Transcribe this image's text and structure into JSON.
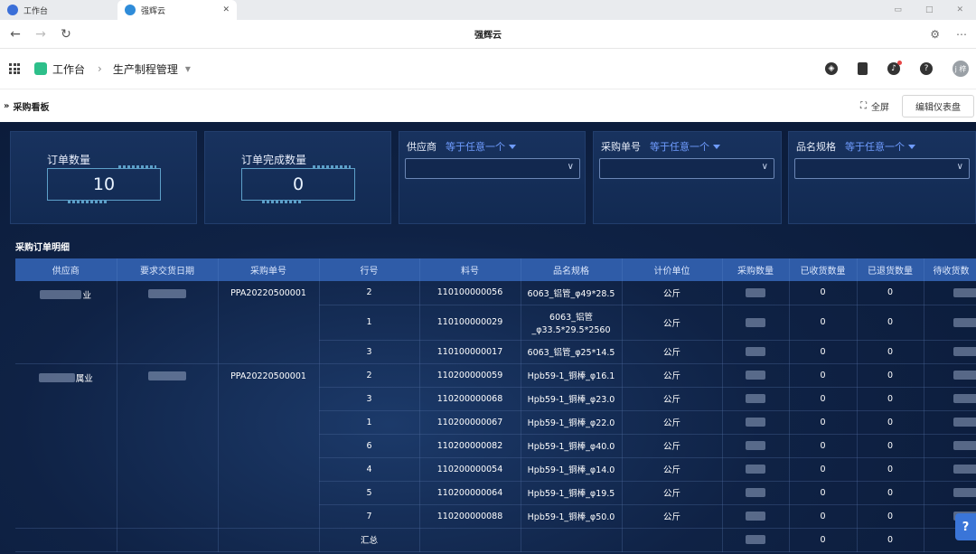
{
  "browser": {
    "tabs": [
      {
        "label": "工作台",
        "icon_color": "#3b6fd8",
        "active": false
      },
      {
        "label": "强辉云",
        "icon_color": "#2f8cd9",
        "active": true
      }
    ],
    "close_glyph": "✕",
    "page_title": "强辉云",
    "nav": {
      "back": "←",
      "forward": "→",
      "refresh": "↻"
    },
    "extras": [
      "⚙",
      "⋯"
    ]
  },
  "app_header": {
    "workspace_label": "工作台",
    "breadcrumb_sep": "›",
    "module_label": "生产制程管理",
    "dropdown_glyph": "▾",
    "icons": [
      "compass-icon",
      "book-icon",
      "bell-icon",
      "help-icon"
    ],
    "help_glyph": "?",
    "avatar_text": "j 梓",
    "notification_color": "#e54545"
  },
  "board": {
    "expand_glyph": "»",
    "title": "采购看板",
    "fullscreen_label": "全屏",
    "fullscreen_glyph": "⛶",
    "edit_label": "编辑仪表盘"
  },
  "stats": [
    {
      "label": "订单数量",
      "value": "10"
    },
    {
      "label": "订单完成数量",
      "value": "0"
    }
  ],
  "filters": [
    {
      "label": "供应商",
      "operator": "等于任意一个",
      "value": ""
    },
    {
      "label": "采购单号",
      "operator": "等于任意一个",
      "value": ""
    },
    {
      "label": "品名规格",
      "operator": "等于任意一个",
      "value": ""
    }
  ],
  "table": {
    "title": "采购订单明细",
    "columns": [
      "供应商",
      "要求交货日期",
      "采购单号",
      "行号",
      "料号",
      "品名规格",
      "计价单位",
      "采购数量",
      "已收货数量",
      "已退货数量",
      "待收货数"
    ],
    "groups": [
      {
        "supplier_suffix": "业",
        "order_no": "PPA20220500001",
        "rows": [
          {
            "line": "2",
            "part": "110100000056",
            "spec": [
              "6063_铝管_φ49*28.5"
            ],
            "unit": "公斤",
            "received": "0",
            "returned": "0"
          },
          {
            "line": "1",
            "part": "110100000029",
            "spec": [
              "6063_铝管",
              "_φ33.5*29.5*2560"
            ],
            "unit": "公斤",
            "received": "0",
            "returned": "0"
          },
          {
            "line": "3",
            "part": "110100000017",
            "spec": [
              "6063_铝管_φ25*14.5"
            ],
            "unit": "公斤",
            "received": "0",
            "returned": "0"
          }
        ]
      },
      {
        "supplier_suffix": "属业",
        "order_no": "PPA20220500001",
        "rows": [
          {
            "line": "2",
            "part": "110200000059",
            "spec": [
              "Hpb59-1_铜棒_φ16.1"
            ],
            "unit": "公斤",
            "received": "0",
            "returned": "0"
          },
          {
            "line": "3",
            "part": "110200000068",
            "spec": [
              "Hpb59-1_铜棒_φ23.0"
            ],
            "unit": "公斤",
            "received": "0",
            "returned": "0"
          },
          {
            "line": "1",
            "part": "110200000067",
            "spec": [
              "Hpb59-1_铜棒_φ22.0"
            ],
            "unit": "公斤",
            "received": "0",
            "returned": "0"
          },
          {
            "line": "6",
            "part": "110200000082",
            "spec": [
              "Hpb59-1_铜棒_φ40.0"
            ],
            "unit": "公斤",
            "received": "0",
            "returned": "0"
          },
          {
            "line": "4",
            "part": "110200000054",
            "spec": [
              "Hpb59-1_铜棒_φ14.0"
            ],
            "unit": "公斤",
            "received": "0",
            "returned": "0"
          },
          {
            "line": "5",
            "part": "110200000064",
            "spec": [
              "Hpb59-1_铜棒_φ19.5"
            ],
            "unit": "公斤",
            "received": "0",
            "returned": "0"
          },
          {
            "line": "7",
            "part": "110200000088",
            "spec": [
              "Hpb59-1_铜棒_φ50.0"
            ],
            "unit": "公斤",
            "received": "0",
            "returned": "0"
          }
        ]
      }
    ],
    "summary": {
      "label": "汇总",
      "received": "0",
      "returned": "0"
    }
  },
  "floating_help": "?"
}
